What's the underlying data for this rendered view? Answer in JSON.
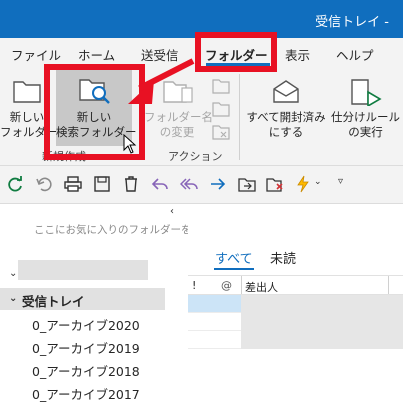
{
  "window": {
    "title": "受信トレイ -"
  },
  "tabs": [
    {
      "label": "ファイル"
    },
    {
      "label": "ホーム"
    },
    {
      "label": "送受信"
    },
    {
      "label": "フォルダー"
    },
    {
      "label": "表示"
    },
    {
      "label": "ヘルプ"
    }
  ],
  "ribbon": {
    "new_folder": {
      "line1": "新しい",
      "line2": "フォルダー"
    },
    "new_search_folder": {
      "line1": "新しい",
      "line2": "検索フォルダー"
    },
    "rename_folder": {
      "line1": "フォルダー名",
      "line2": "の変更"
    },
    "mark_all_read": {
      "line1": "すべて開封済み",
      "line2": "にする"
    },
    "run_rules": {
      "line1": "仕分けルール",
      "line2": "の実行"
    },
    "group_new": "新規作成",
    "group_actions": "アクション"
  },
  "nav": {
    "favorites_hint": "ここにお気に入りのフォルダーをド",
    "collapse_glyph": "‹",
    "inbox": "受信トレイ",
    "folders": [
      "0_アーカイブ2020",
      "0_アーカイブ2019",
      "0_アーカイブ2018",
      "0_アーカイブ2017"
    ]
  },
  "messages": {
    "tab_all": "すべて",
    "tab_unread": "未読",
    "col_importance": "!",
    "col_attachment": "@",
    "col_from": "差出人"
  },
  "colors": {
    "accent": "#106ebe",
    "highlight": "#e81123"
  }
}
